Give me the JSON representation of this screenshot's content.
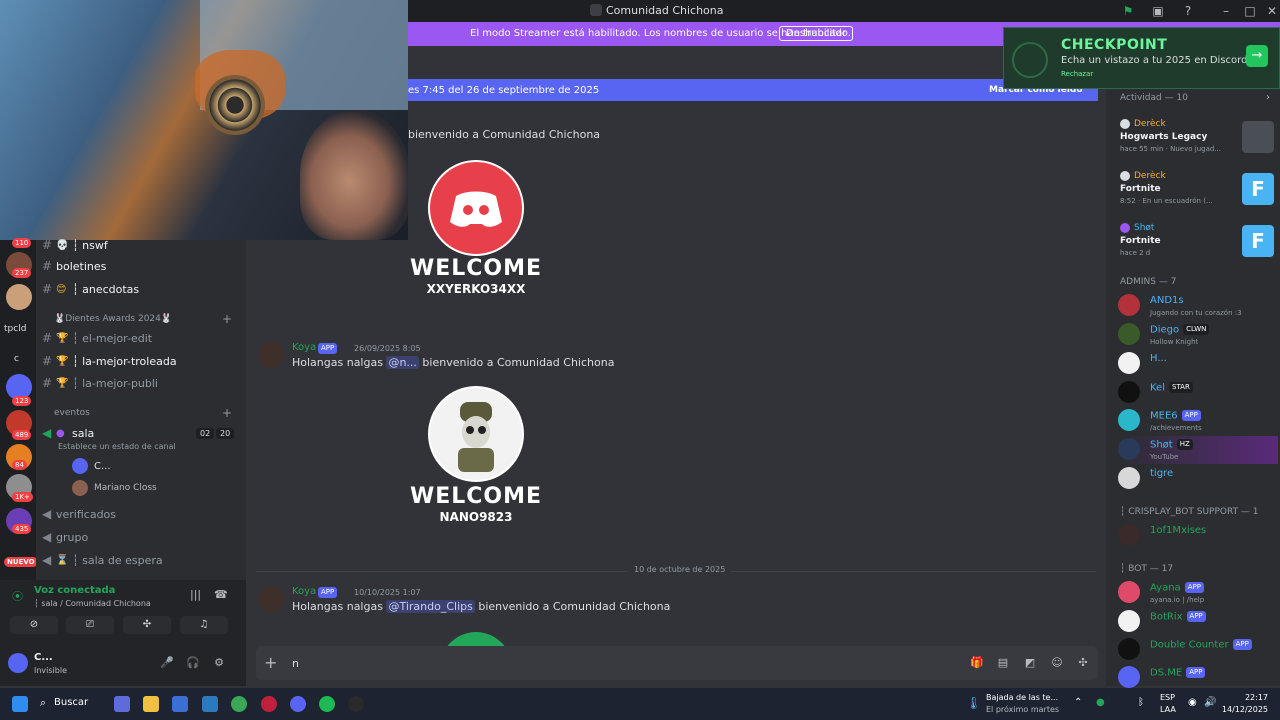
{
  "window": {
    "title": "Comunidad Chichona"
  },
  "streamer_bar": {
    "message": "El modo Streamer está habilitado. Los nombres de usuario se han truncado.",
    "button": "Deshabilitar"
  },
  "checkpoint": {
    "title": "CHECKPOINT",
    "subtitle": "Echa un vistazo a tu 2025 en Discord",
    "reject": "Rechazar"
  },
  "new_messages": {
    "text": "es 7:45 del 26 de septiembre de 2025",
    "mark_read": "Marcar como leído"
  },
  "rail": {
    "badges": [
      "110",
      "237",
      "123",
      "489",
      "84",
      "1K+",
      "435"
    ],
    "labels": [
      "tpcld",
      "c"
    ],
    "new": "NUEVO"
  },
  "channels": {
    "items": [
      {
        "name": "┆ nswf",
        "icon": "💀"
      },
      {
        "name": "boletines",
        "icon": ""
      },
      {
        "name": "┆ anecdotas",
        "icon": "😊"
      },
      {
        "name": "┆ el-mejor-edit",
        "icon": "🏆"
      },
      {
        "name": "┆ la-mejor-troleada",
        "icon": "🏆"
      },
      {
        "name": "┆ la-mejor-publi",
        "icon": "🏆"
      }
    ],
    "category1": "🐰Dientes Awards 2024🐰",
    "category2": "eventos",
    "voice_channel": "sala",
    "voice_status": "Establece un estado de canal",
    "voice_counts": [
      "02",
      "20"
    ],
    "voice_users": [
      "C...",
      "Mariano Closs"
    ],
    "extra": [
      "verificados",
      "grupo",
      "┆ sala de espera"
    ]
  },
  "voice_panel": {
    "status": "Voz conectada",
    "location": "┆ sala / Comunidad Chichona",
    "user": "C...",
    "user_status": "Invisible"
  },
  "messages": {
    "date_top": "26 de septiembre de 2025",
    "welcome_text": "bienvenido a Comunidad Chichona",
    "card1": {
      "big": "WELCOME",
      "small": "XXYERKO34XX"
    },
    "msg2": {
      "author": "Koya",
      "badge": "APP",
      "time": "26/09/2025 8:05",
      "pre": "Holangas nalgas ",
      "mention": "@n...",
      "post": " bienvenido a Comunidad Chichona"
    },
    "card2": {
      "big": "WELCOME",
      "small": "NANO9823"
    },
    "divider": "10 de octubre de 2025",
    "msg3": {
      "author": "Koya",
      "badge": "APP",
      "time": "10/10/2025 1:07",
      "pre": "Holangas nalgas ",
      "mention": "@Tirando_Clips",
      "post": " bienvenido a Comunidad Chichona"
    }
  },
  "composer": {
    "value": "n"
  },
  "activity": {
    "header": "Actividad — 10",
    "items": [
      {
        "user": "Derèck",
        "game": "Hogwarts Legacy",
        "status": "hace 55 min  ·  Nuevo jugad..."
      },
      {
        "user": "Derèck",
        "game": "Fortnite",
        "status": "8:52  ·  En un escuadrón (..."
      },
      {
        "user": "Shøt",
        "game": "Fortnite",
        "status": "hace 2 d"
      }
    ]
  },
  "members": {
    "admins_header": "ADMINS — 7",
    "admins": [
      {
        "name": "AND1s",
        "sub": "Jugando con tu corazón :3",
        "tag": ""
      },
      {
        "name": "Diego",
        "sub": "Hollow Knight",
        "tag": "CLWN"
      },
      {
        "name": "H...",
        "sub": "",
        "tag": ""
      },
      {
        "name": "Kel",
        "sub": "",
        "tag": "STAR"
      },
      {
        "name": "MEE6",
        "sub": "/achievements",
        "tag": "APP"
      },
      {
        "name": "Shøt",
        "sub": "YouTube",
        "tag": "HZ"
      },
      {
        "name": "tigre",
        "sub": "",
        "tag": ""
      }
    ],
    "crisplay_header": "┆ CRISPLAY_BOT SUPPORT — 1",
    "crisplay": [
      {
        "name": "1of1Mxises",
        "sub": "",
        "tag": ""
      }
    ],
    "bot_header": "┆ BOT — 17",
    "bots": [
      {
        "name": "Ayana",
        "sub": "ayana.io | /help",
        "tag": "APP"
      },
      {
        "name": "BotRix",
        "sub": "",
        "tag": "APP"
      },
      {
        "name": "Double Counter",
        "sub": "",
        "tag": "APP"
      },
      {
        "name": "DS.ME",
        "sub": "",
        "tag": "APP"
      }
    ]
  },
  "taskbar": {
    "search": "Buscar",
    "weather1": "Bajada de las te...",
    "weather2": "El próximo martes",
    "lang1": "ESP",
    "lang2": "LAA",
    "time": "22:17",
    "date": "14/12/2025"
  }
}
